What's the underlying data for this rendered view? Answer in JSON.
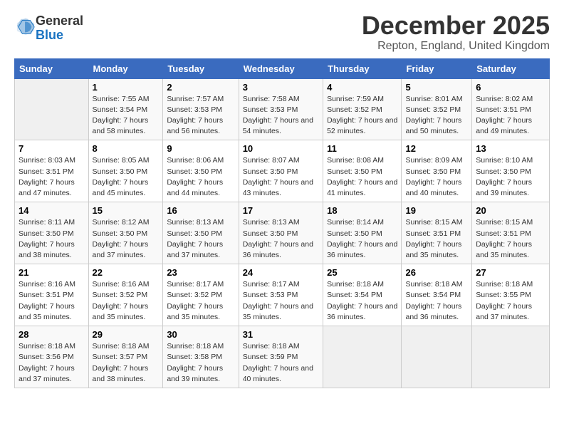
{
  "logo": {
    "general": "General",
    "blue": "Blue"
  },
  "title": "December 2025",
  "subtitle": "Repton, England, United Kingdom",
  "days_header": [
    "Sunday",
    "Monday",
    "Tuesday",
    "Wednesday",
    "Thursday",
    "Friday",
    "Saturday"
  ],
  "weeks": [
    [
      {
        "day": "",
        "empty": true
      },
      {
        "day": "1",
        "sunrise": "Sunrise: 7:55 AM",
        "sunset": "Sunset: 3:54 PM",
        "daylight": "Daylight: 7 hours and 58 minutes."
      },
      {
        "day": "2",
        "sunrise": "Sunrise: 7:57 AM",
        "sunset": "Sunset: 3:53 PM",
        "daylight": "Daylight: 7 hours and 56 minutes."
      },
      {
        "day": "3",
        "sunrise": "Sunrise: 7:58 AM",
        "sunset": "Sunset: 3:53 PM",
        "daylight": "Daylight: 7 hours and 54 minutes."
      },
      {
        "day": "4",
        "sunrise": "Sunrise: 7:59 AM",
        "sunset": "Sunset: 3:52 PM",
        "daylight": "Daylight: 7 hours and 52 minutes."
      },
      {
        "day": "5",
        "sunrise": "Sunrise: 8:01 AM",
        "sunset": "Sunset: 3:52 PM",
        "daylight": "Daylight: 7 hours and 50 minutes."
      },
      {
        "day": "6",
        "sunrise": "Sunrise: 8:02 AM",
        "sunset": "Sunset: 3:51 PM",
        "daylight": "Daylight: 7 hours and 49 minutes."
      }
    ],
    [
      {
        "day": "7",
        "sunrise": "Sunrise: 8:03 AM",
        "sunset": "Sunset: 3:51 PM",
        "daylight": "Daylight: 7 hours and 47 minutes."
      },
      {
        "day": "8",
        "sunrise": "Sunrise: 8:05 AM",
        "sunset": "Sunset: 3:50 PM",
        "daylight": "Daylight: 7 hours and 45 minutes."
      },
      {
        "day": "9",
        "sunrise": "Sunrise: 8:06 AM",
        "sunset": "Sunset: 3:50 PM",
        "daylight": "Daylight: 7 hours and 44 minutes."
      },
      {
        "day": "10",
        "sunrise": "Sunrise: 8:07 AM",
        "sunset": "Sunset: 3:50 PM",
        "daylight": "Daylight: 7 hours and 43 minutes."
      },
      {
        "day": "11",
        "sunrise": "Sunrise: 8:08 AM",
        "sunset": "Sunset: 3:50 PM",
        "daylight": "Daylight: 7 hours and 41 minutes."
      },
      {
        "day": "12",
        "sunrise": "Sunrise: 8:09 AM",
        "sunset": "Sunset: 3:50 PM",
        "daylight": "Daylight: 7 hours and 40 minutes."
      },
      {
        "day": "13",
        "sunrise": "Sunrise: 8:10 AM",
        "sunset": "Sunset: 3:50 PM",
        "daylight": "Daylight: 7 hours and 39 minutes."
      }
    ],
    [
      {
        "day": "14",
        "sunrise": "Sunrise: 8:11 AM",
        "sunset": "Sunset: 3:50 PM",
        "daylight": "Daylight: 7 hours and 38 minutes."
      },
      {
        "day": "15",
        "sunrise": "Sunrise: 8:12 AM",
        "sunset": "Sunset: 3:50 PM",
        "daylight": "Daylight: 7 hours and 37 minutes."
      },
      {
        "day": "16",
        "sunrise": "Sunrise: 8:13 AM",
        "sunset": "Sunset: 3:50 PM",
        "daylight": "Daylight: 7 hours and 37 minutes."
      },
      {
        "day": "17",
        "sunrise": "Sunrise: 8:13 AM",
        "sunset": "Sunset: 3:50 PM",
        "daylight": "Daylight: 7 hours and 36 minutes."
      },
      {
        "day": "18",
        "sunrise": "Sunrise: 8:14 AM",
        "sunset": "Sunset: 3:50 PM",
        "daylight": "Daylight: 7 hours and 36 minutes."
      },
      {
        "day": "19",
        "sunrise": "Sunrise: 8:15 AM",
        "sunset": "Sunset: 3:51 PM",
        "daylight": "Daylight: 7 hours and 35 minutes."
      },
      {
        "day": "20",
        "sunrise": "Sunrise: 8:15 AM",
        "sunset": "Sunset: 3:51 PM",
        "daylight": "Daylight: 7 hours and 35 minutes."
      }
    ],
    [
      {
        "day": "21",
        "sunrise": "Sunrise: 8:16 AM",
        "sunset": "Sunset: 3:51 PM",
        "daylight": "Daylight: 7 hours and 35 minutes."
      },
      {
        "day": "22",
        "sunrise": "Sunrise: 8:16 AM",
        "sunset": "Sunset: 3:52 PM",
        "daylight": "Daylight: 7 hours and 35 minutes."
      },
      {
        "day": "23",
        "sunrise": "Sunrise: 8:17 AM",
        "sunset": "Sunset: 3:52 PM",
        "daylight": "Daylight: 7 hours and 35 minutes."
      },
      {
        "day": "24",
        "sunrise": "Sunrise: 8:17 AM",
        "sunset": "Sunset: 3:53 PM",
        "daylight": "Daylight: 7 hours and 35 minutes."
      },
      {
        "day": "25",
        "sunrise": "Sunrise: 8:18 AM",
        "sunset": "Sunset: 3:54 PM",
        "daylight": "Daylight: 7 hours and 36 minutes."
      },
      {
        "day": "26",
        "sunrise": "Sunrise: 8:18 AM",
        "sunset": "Sunset: 3:54 PM",
        "daylight": "Daylight: 7 hours and 36 minutes."
      },
      {
        "day": "27",
        "sunrise": "Sunrise: 8:18 AM",
        "sunset": "Sunset: 3:55 PM",
        "daylight": "Daylight: 7 hours and 37 minutes."
      }
    ],
    [
      {
        "day": "28",
        "sunrise": "Sunrise: 8:18 AM",
        "sunset": "Sunset: 3:56 PM",
        "daylight": "Daylight: 7 hours and 37 minutes."
      },
      {
        "day": "29",
        "sunrise": "Sunrise: 8:18 AM",
        "sunset": "Sunset: 3:57 PM",
        "daylight": "Daylight: 7 hours and 38 minutes."
      },
      {
        "day": "30",
        "sunrise": "Sunrise: 8:18 AM",
        "sunset": "Sunset: 3:58 PM",
        "daylight": "Daylight: 7 hours and 39 minutes."
      },
      {
        "day": "31",
        "sunrise": "Sunrise: 8:18 AM",
        "sunset": "Sunset: 3:59 PM",
        "daylight": "Daylight: 7 hours and 40 minutes."
      },
      {
        "day": "",
        "empty": true
      },
      {
        "day": "",
        "empty": true
      },
      {
        "day": "",
        "empty": true
      }
    ]
  ]
}
